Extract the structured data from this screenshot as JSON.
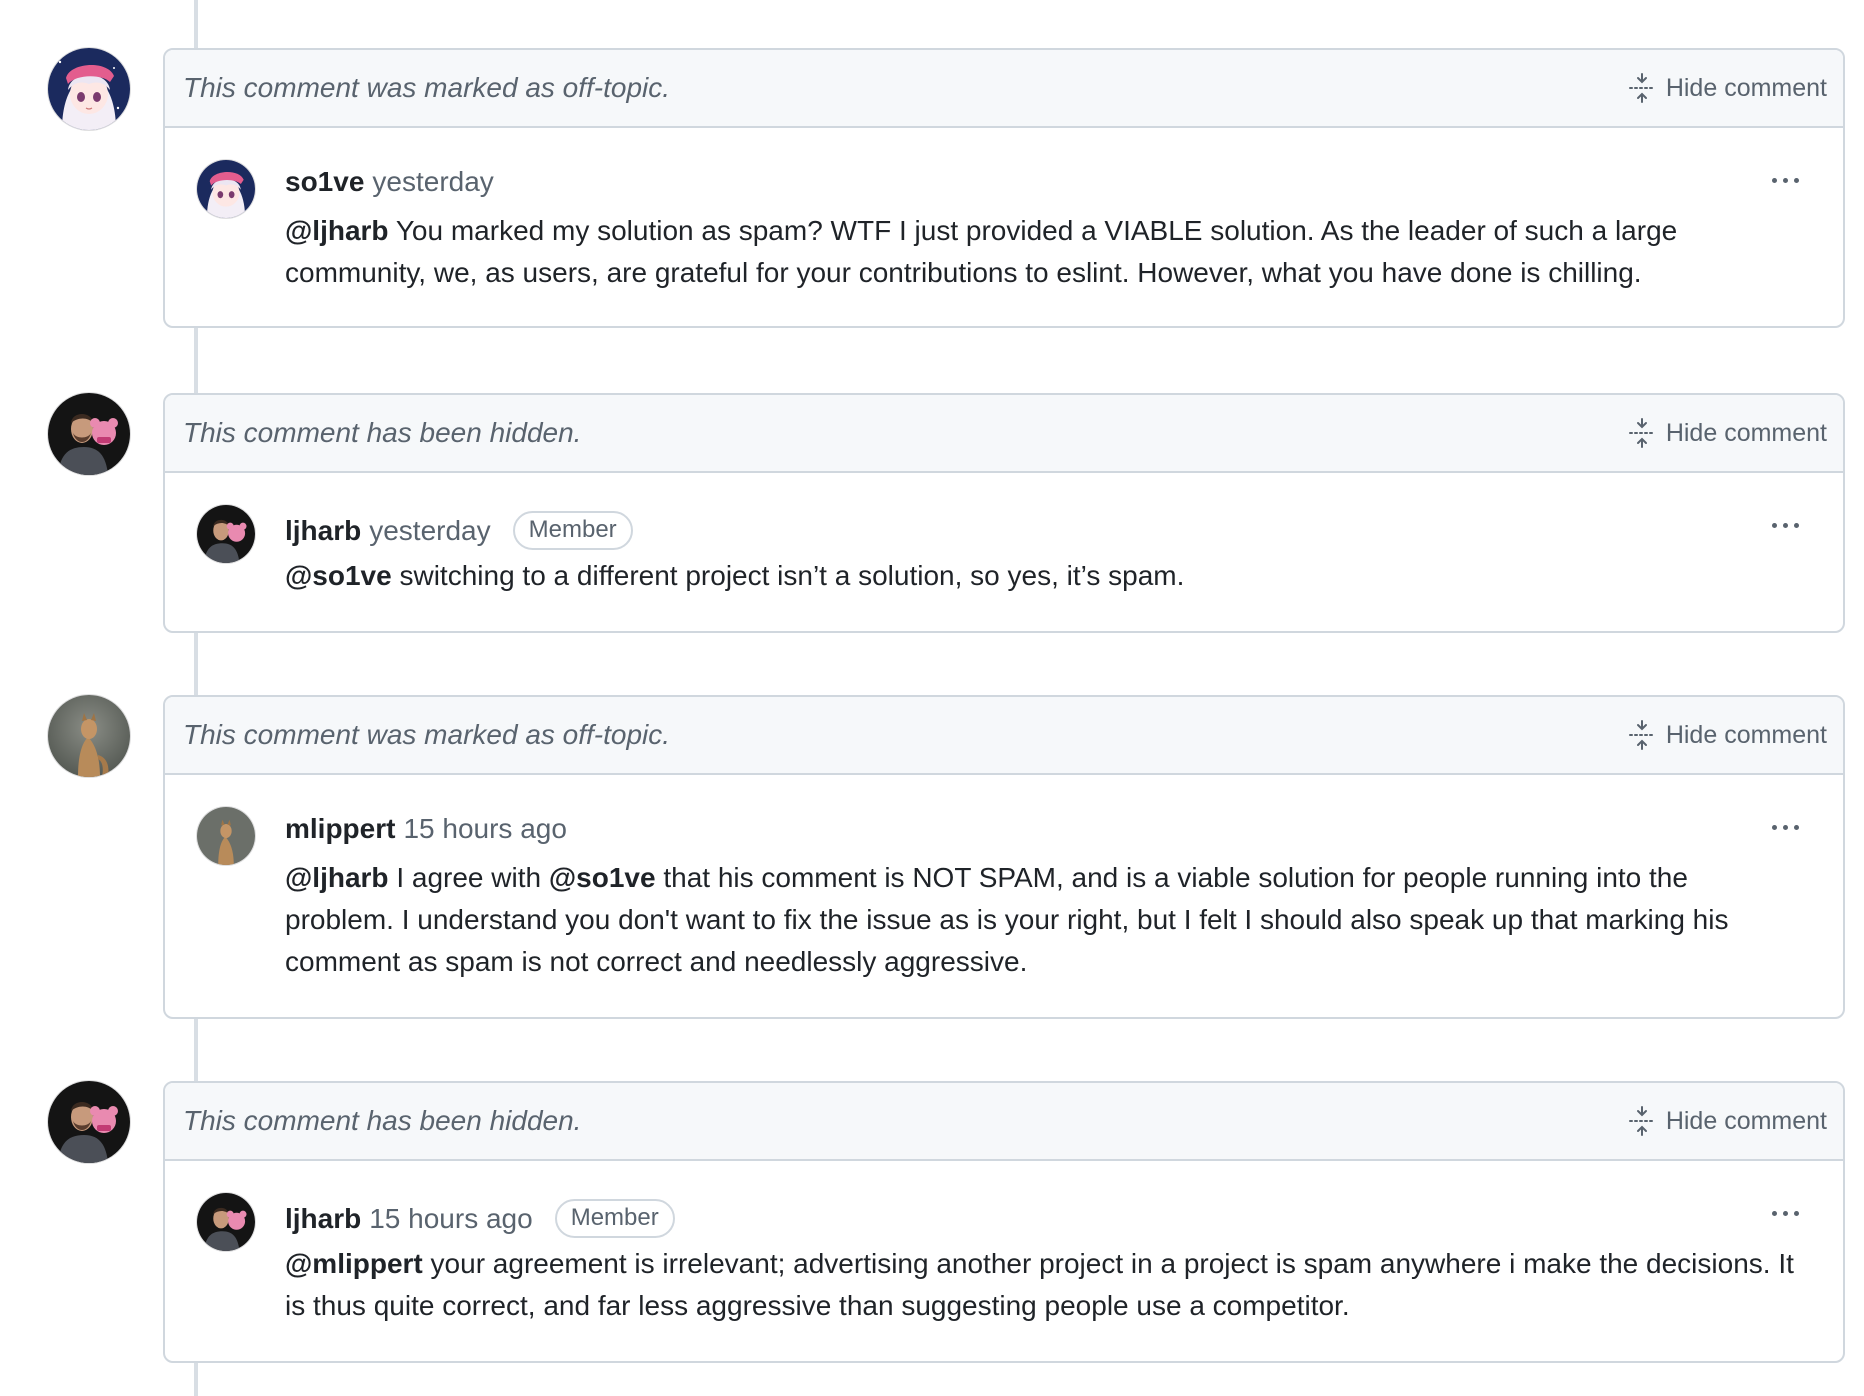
{
  "colors": {
    "header_bg": "#f6f8fa",
    "border": "#d0d7de",
    "muted_text": "#59636e",
    "primary_text": "#1f2328",
    "timeline": "#d8dee4"
  },
  "icons": {
    "hide": "fold-icon",
    "menu": "kebab-horizontal-icon",
    "so1ve_avatar": "anime-girl-avatar",
    "ljharb_avatar": "person-with-bear-avatar",
    "mlippert_avatar": "mountain-lion-avatar"
  },
  "comments": [
    {
      "header_text": "This comment was marked as off-topic.",
      "hide_label": "Hide comment",
      "author": "so1ve",
      "timestamp": "yesterday",
      "badge": "",
      "body": {
        "line1_mention": "@ljharb",
        "line1_text": " You marked my solution as spam? WTF I just provided a VIABLE solution. As the leader of such a large community, we, as users, are grateful for your contributions to eslint. However, what you have done is chilling."
      }
    },
    {
      "header_text": "This comment has been hidden.",
      "hide_label": "Hide comment",
      "author": "ljharb",
      "timestamp": "yesterday",
      "badge": "Member",
      "body": {
        "line1_mention": "@so1ve",
        "line1_text": " switching to a different project isn’t a solution, so yes, it’s spam."
      }
    },
    {
      "header_text": "This comment was marked as off-topic.",
      "hide_label": "Hide comment",
      "author": "mlippert",
      "timestamp": "15 hours ago",
      "badge": "",
      "body": {
        "mention1": "@ljharb",
        "text1": " I agree with ",
        "mention2": "@so1ve",
        "text2": " that his comment is NOT SPAM, and is a viable solution for people running into the problem. I understand you don't want to fix the issue as is your right, but I felt I should also speak up that marking his comment as spam is not correct and needlessly aggressive."
      }
    },
    {
      "header_text": "This comment has been hidden.",
      "hide_label": "Hide comment",
      "author": "ljharb",
      "timestamp": "15 hours ago",
      "badge": "Member",
      "body": {
        "line1_mention": "@mlippert",
        "line1_text": " your agreement is irrelevant; advertising another project in a project is spam anywhere i make the decisions. It is thus quite correct, and far less aggressive than suggesting people use a competitor."
      }
    }
  ]
}
